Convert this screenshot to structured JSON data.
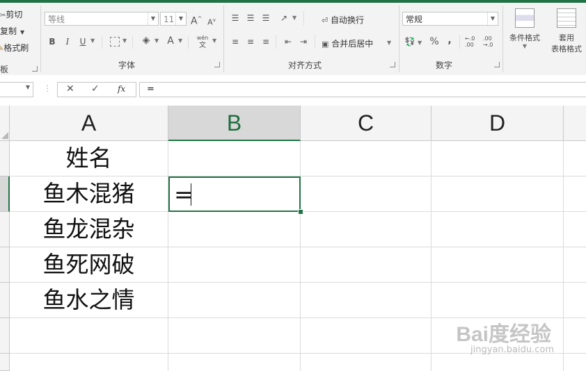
{
  "clipboard": {
    "cut_label": "剪切",
    "copy_label": "复制",
    "format_painter_label": "格式刷",
    "group_label_partial": "板"
  },
  "font": {
    "font_name": "等线",
    "font_size": "11",
    "bold": "B",
    "italic": "I",
    "underline": "U",
    "grow": "A",
    "shrink": "A",
    "font_color_glyph": "A",
    "phonetic_glyph": "wén",
    "phonetic_glyph_2": "文",
    "group_label": "字体"
  },
  "alignment": {
    "wrap_text_label": "自动换行",
    "merge_center_label": "合并后居中",
    "group_label": "对齐方式"
  },
  "number": {
    "format_value": "常规",
    "percent": "%",
    "comma": ",",
    "inc_decimal": "←.0\n.00",
    "dec_decimal": ".00\n→.0",
    "group_label": "数字"
  },
  "styles": {
    "conditional_format_label": "条件格式",
    "table_format_label_1": "套用",
    "table_format_label_2": "表格格式"
  },
  "formula_bar": {
    "cancel_glyph": "✕",
    "enter_glyph": "✓",
    "fx_glyph": "fx",
    "content": "="
  },
  "grid": {
    "columns": [
      "A",
      "B",
      "C",
      "D"
    ],
    "selected_column": "B",
    "cells_A": [
      "姓名",
      "鱼木混猪",
      "鱼龙混杂",
      "鱼死网破",
      "鱼水之情"
    ],
    "active_cell_value": "="
  },
  "watermark": {
    "line1": "Bai度经验",
    "line2": "jingyan.baidu.com"
  },
  "colors": {
    "accent": "#217346",
    "ribbon_bg": "#f3f3f3"
  }
}
